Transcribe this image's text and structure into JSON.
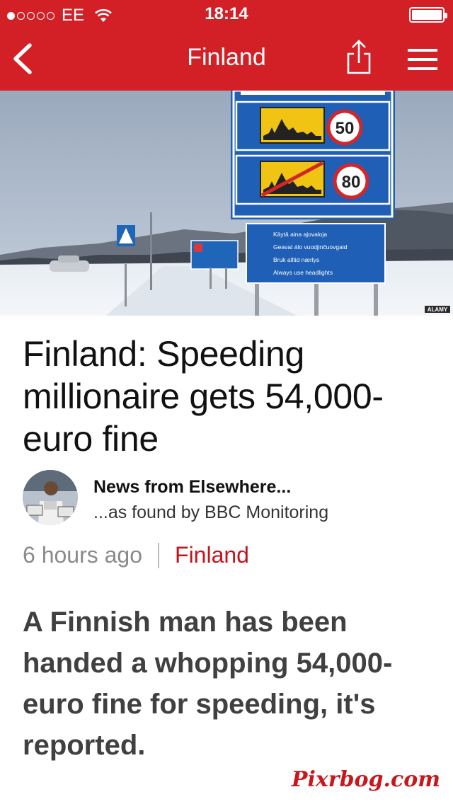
{
  "status_bar": {
    "signal_dots_filled": 1,
    "signal_dots_total": 5,
    "carrier": "EE",
    "time": "18:14",
    "battery_level": 0.9
  },
  "nav": {
    "title": "Finland",
    "back_icon": "chevron-left-icon",
    "share_icon": "share-icon",
    "menu_icon": "hamburger-menu-icon"
  },
  "hero": {
    "sign_limit_1": "50",
    "sign_limit_2": "80",
    "sign_text": [
      "Käytä aina ajovaloja",
      "Geavat álo vuodjinčuovgaid",
      "Bruk alltid nærlys",
      "Always use headlights"
    ],
    "credit": "ALAMY"
  },
  "article": {
    "headline": "Finland: Speeding millionaire gets 54,000-euro fine",
    "author": "News from Elsewhere...",
    "source": "...as found by BBC Monitoring",
    "time": "6 hours ago",
    "topic": "Finland",
    "summary": "A Finnish man has been handed a whopping 54,000-euro fine for speeding, it's reported."
  },
  "watermark": "Pixrbog.com",
  "colors": {
    "brand_red": "#d32026",
    "topic_red": "#c4131b",
    "text_dark": "#111111",
    "text_gray": "#8a8a8a"
  }
}
